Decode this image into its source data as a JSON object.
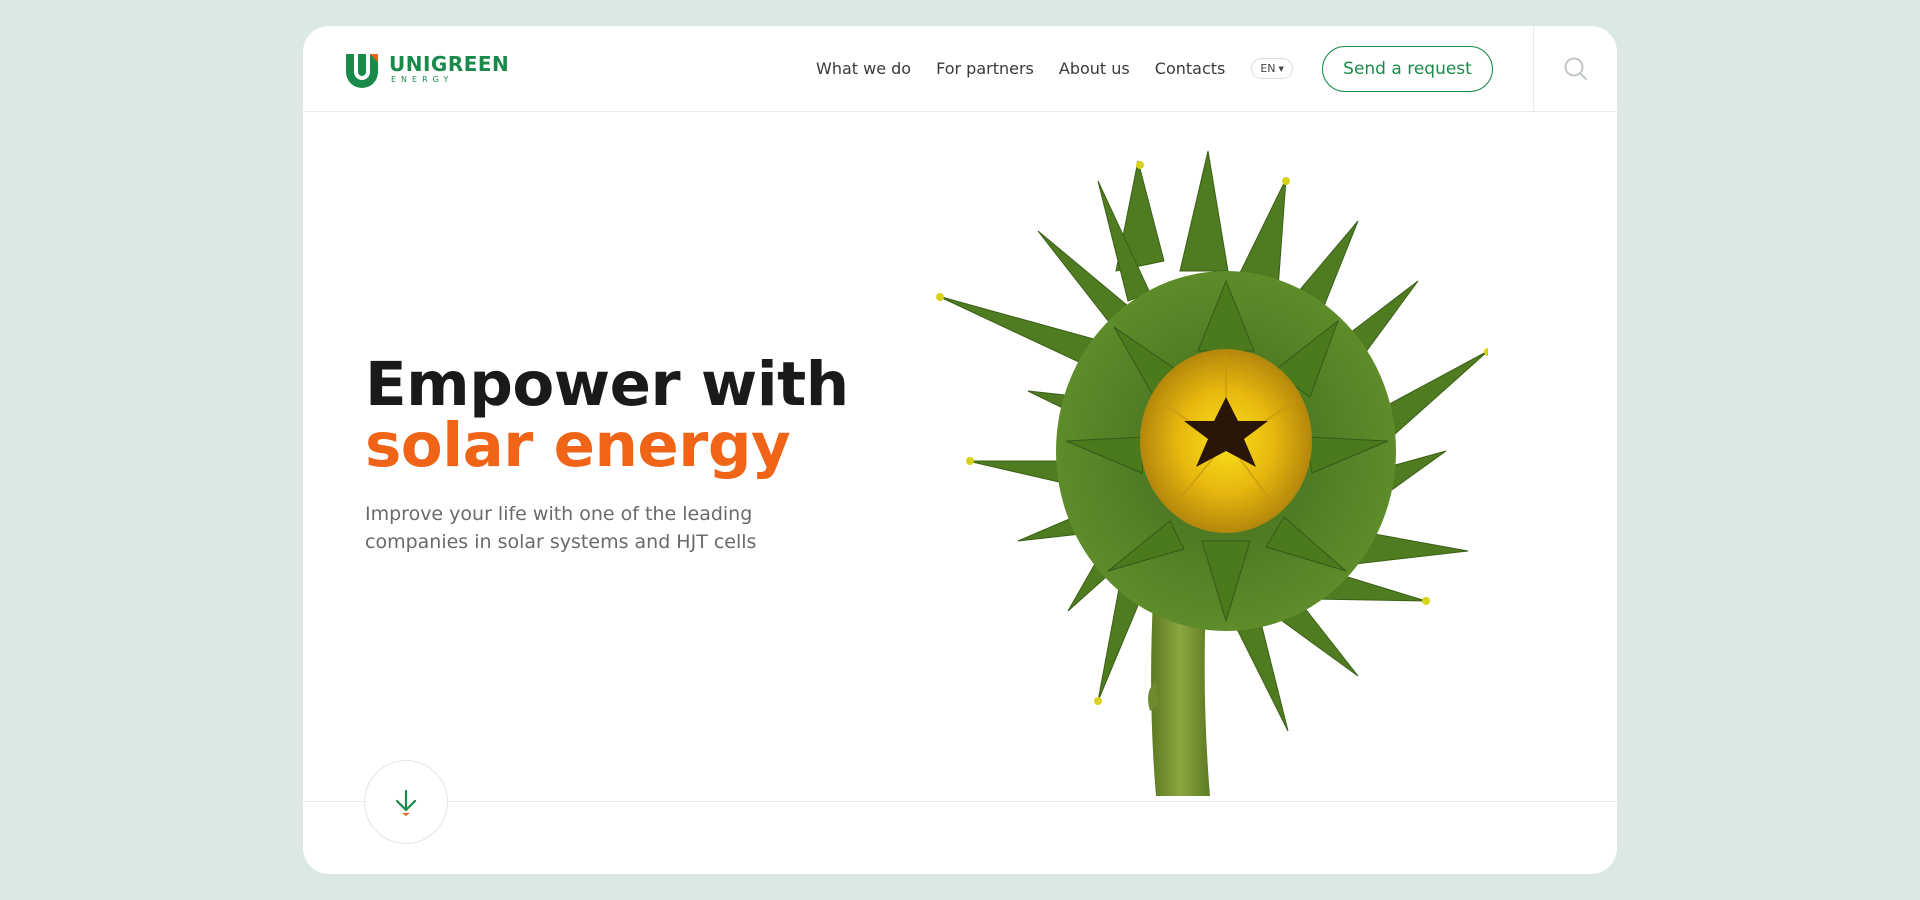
{
  "brand": {
    "name": "UNIGREEN",
    "sub": "ENERGY",
    "primary_color": "#1a8a4a",
    "accent_color": "#f06418"
  },
  "nav": {
    "items": [
      {
        "label": "What we do"
      },
      {
        "label": "For partners"
      },
      {
        "label": "About us"
      },
      {
        "label": "Contacts"
      }
    ],
    "language": "EN"
  },
  "header": {
    "cta_label": "Send a request",
    "search_icon": "search-icon"
  },
  "hero": {
    "title_line1": "Empower with",
    "title_line2": "solar energy",
    "subtitle": "Improve your life with one of the leading companies in solar systems and HJT cells",
    "image": "sunflower-bud",
    "scroll_icon": "arrow-down-icon"
  }
}
